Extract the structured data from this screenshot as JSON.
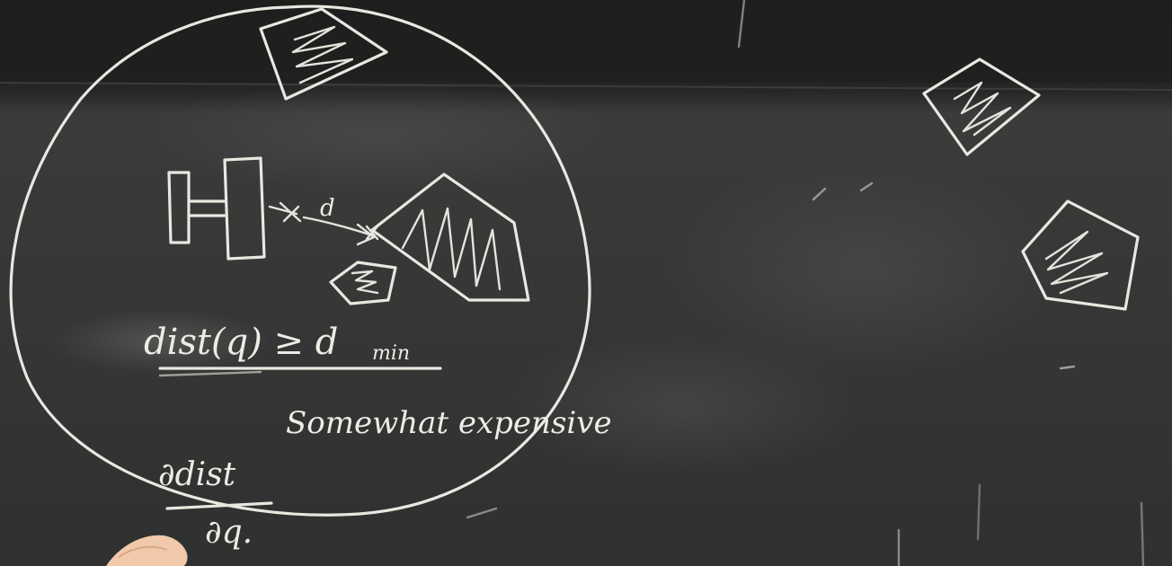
{
  "image": {
    "subject": "chalkboard",
    "colors": {
      "board_top": "#1f2120",
      "board_main": "#3a3c3b",
      "board_smudge": "#5a5c5a",
      "chalk": "#e8e8e0",
      "hand": "#f4c8a8"
    }
  },
  "board": {
    "constraint_text": "dist(q) ≥ d",
    "constraint_subscript": "min",
    "cost_note": "Somewhat expensive",
    "distance_label": "d",
    "derivative_numerator": "∂dist",
    "derivative_denominator": "∂q."
  }
}
